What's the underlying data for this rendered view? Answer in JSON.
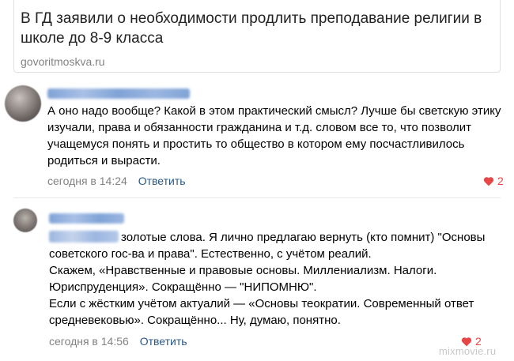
{
  "link": {
    "title": "В ГД заявили о необходимости продлить преподавание религии в школе до 8-9 класса",
    "domain": "govoritmoskva.ru"
  },
  "comments": [
    {
      "text": "А оно надо вообще? Какой в этом практический смысл? Лучше бы светскую этику изучали, права и обязанности гражданина и т.д. словом все то, что позволит учащемуся понять и простить то общество в котором ему посчастливилось родиться и вырасти.",
      "time": "сегодня в 14:24",
      "reply_label": "Ответить",
      "likes": "2"
    },
    {
      "text": "золотые слова. Я лично предлагаю вернуть (кто помнит) \"Основы советского гос-ва и права\". Естественно, с учётом реалий.\nСкажем, «Нравственные и правовые основы. Миллениализм. Налоги. Юриспруденция». Сокращённо — \"НИПОМНЮ\".\nЕсли с жёстким учётом актуалий — «Основы теократии. Современный ответ средневековью». Сокращённо... Ну, думаю, понятно.",
      "time": "сегодня в 14:56",
      "reply_label": "Ответить",
      "likes": "2"
    }
  ],
  "watermark": "mixmovie.ru",
  "colors": {
    "link_blue": "#2a5885",
    "meta_gray": "#828282",
    "like_red": "#e64646"
  },
  "icons": [
    "heart-icon"
  ]
}
